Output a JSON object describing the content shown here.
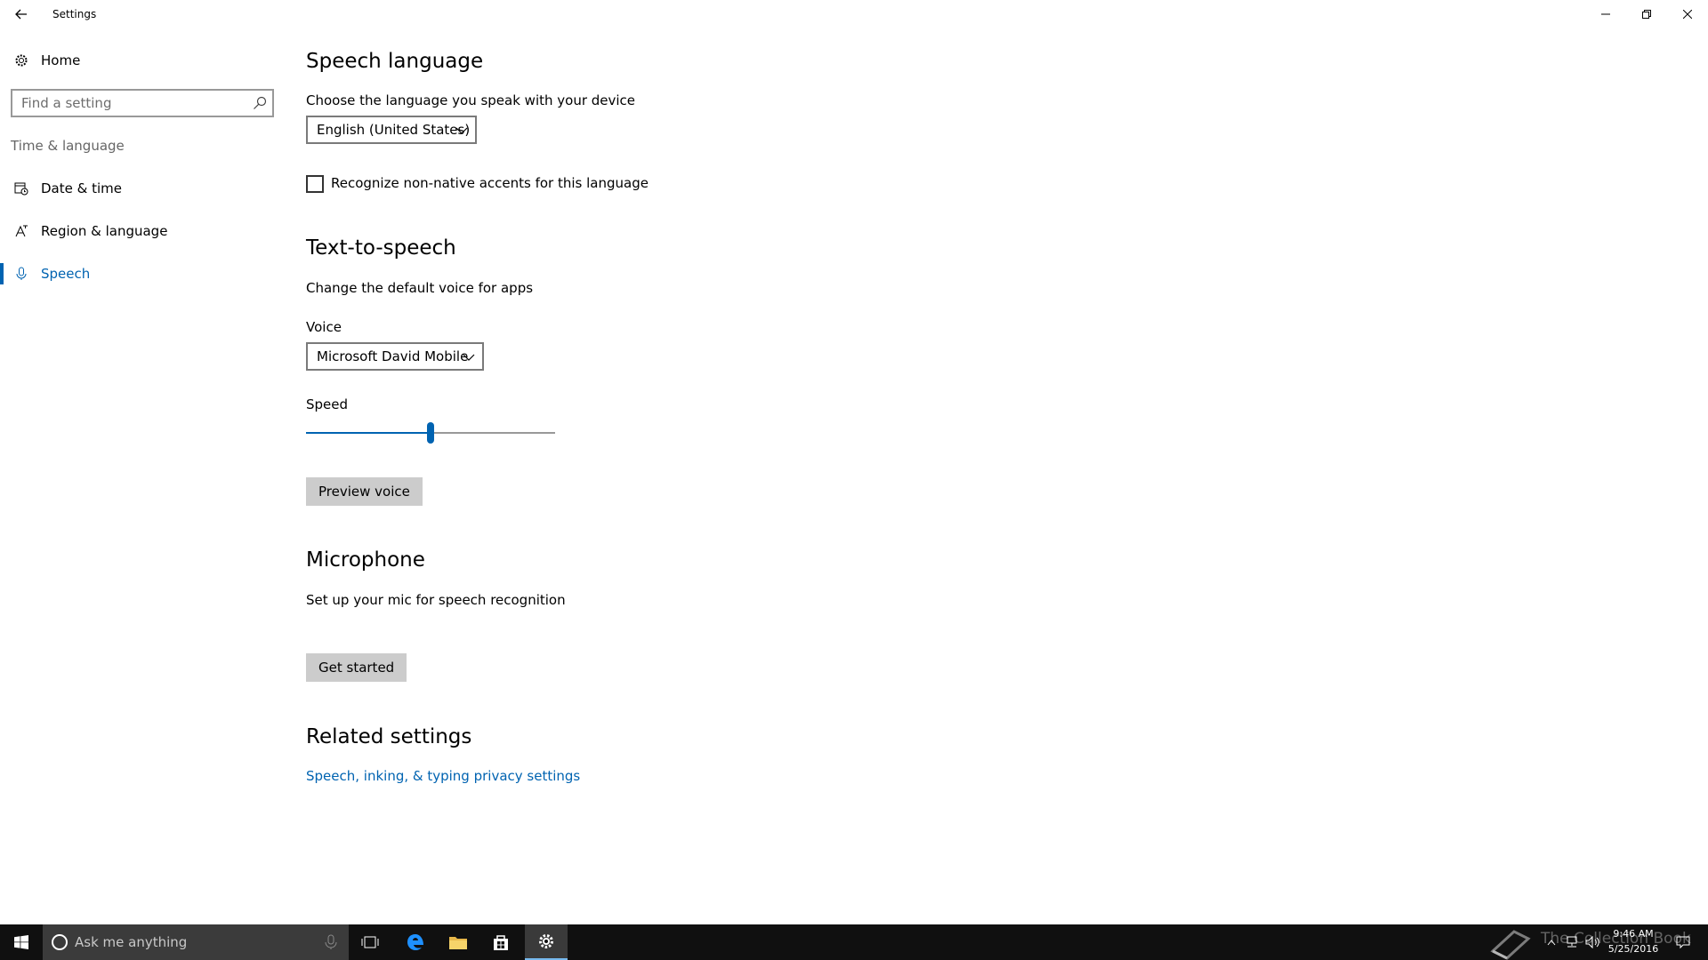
{
  "window": {
    "title": "Settings",
    "back_icon": "back-arrow-icon",
    "controls": [
      "minimize-icon",
      "restore-icon",
      "close-icon"
    ]
  },
  "sidebar": {
    "home_label": "Home",
    "search": {
      "placeholder": "Find a setting",
      "value": ""
    },
    "group_label": "Time & language",
    "items": [
      {
        "label": "Date & time",
        "icon": "calendar-clock-icon",
        "selected": false
      },
      {
        "label": "Region & language",
        "icon": "region-language-icon",
        "selected": false
      },
      {
        "label": "Speech",
        "icon": "microphone-icon",
        "selected": true
      }
    ]
  },
  "main": {
    "speech_language": {
      "heading": "Speech language",
      "description": "Choose the language you speak with your device",
      "language_selected": "English (United States)",
      "accents_checkbox_label": "Recognize non-native accents for this language",
      "accents_checked": false
    },
    "tts": {
      "heading": "Text-to-speech",
      "description": "Change the default voice for apps",
      "voice_label": "Voice",
      "voice_selected": "Microsoft David Mobile",
      "speed_label": "Speed",
      "speed_fraction": 0.5,
      "preview_button": "Preview voice"
    },
    "microphone": {
      "heading": "Microphone",
      "description": "Set up your mic for speech recognition",
      "get_started_button": "Get started"
    },
    "related": {
      "heading": "Related settings",
      "link": "Speech, inking, & typing privacy settings"
    }
  },
  "taskbar": {
    "cortana_placeholder": "Ask me anything",
    "time": "9:46 AM",
    "date": "5/25/2016",
    "watermark": "The Collection Book",
    "accent_color": "#0063b1"
  }
}
